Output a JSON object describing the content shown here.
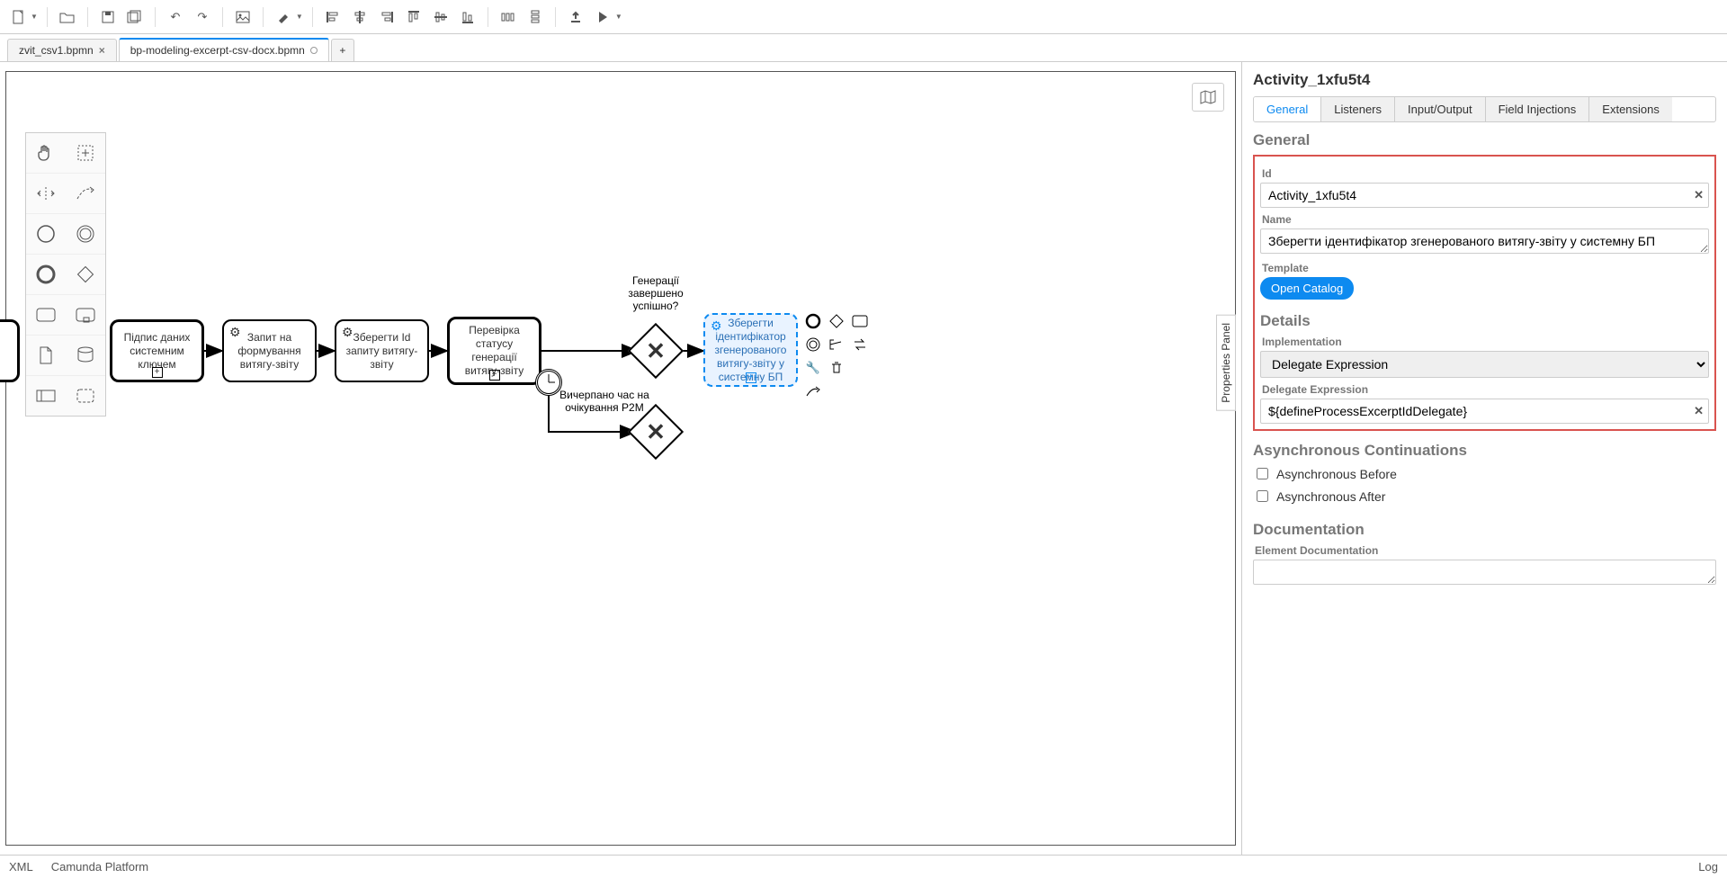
{
  "toolbar": {
    "new": "new",
    "open": "open",
    "save": "save",
    "saveall": "save-all",
    "undo": "undo",
    "redo": "redo",
    "image": "export-image",
    "paint": "color",
    "alignL": "align-left",
    "alignC": "align-center",
    "alignR": "align-right",
    "distH": "distribute-h",
    "distV": "distribute-v",
    "distV2": "distribute",
    "alignT": "align-top",
    "alignB": "align-bottom",
    "upload": "upload",
    "play": "deploy"
  },
  "tabs": {
    "items": [
      {
        "label": "zvit_csv1.bpmn",
        "active": false,
        "dirty": false
      },
      {
        "label": "bp-modeling-excerpt-csv-docx.bpmn",
        "active": true,
        "dirty": true
      }
    ]
  },
  "propsToggle": "Properties Panel",
  "props": {
    "title": "Activity_1xfu5t4",
    "tabs": [
      "General",
      "Listeners",
      "Input/Output",
      "Field Injections",
      "Extensions"
    ],
    "activeTab": 0,
    "sectionGeneral": "General",
    "idLabel": "Id",
    "idValue": "Activity_1xfu5t4",
    "nameLabel": "Name",
    "nameValue": "Зберегти ідентифікатор згенерованого витягу-звіту у системну БП",
    "templateLabel": "Template",
    "openCatalog": "Open Catalog",
    "sectionDetails": "Details",
    "implLabel": "Implementation",
    "implValue": "Delegate Expression",
    "delExpLabel": "Delegate Expression",
    "delExpValue": "${defineProcessExcerptIdDelegate}",
    "sectionAsync": "Asynchronous Continuations",
    "asyncBefore": "Asynchronous Before",
    "asyncAfter": "Asynchronous After",
    "sectionDoc": "Documentation",
    "elemDocLabel": "Element Documentation"
  },
  "diagram": {
    "task1": "Підпис даних системним ключем",
    "task2": "Запит на формування витягу-звіту",
    "task3": "Зберегти Id запиту витягу-звіту",
    "task4": "Перевірка статусу генерації витягу-звіту",
    "task5": "Зберегти ідентифікатор згенерованого витягу-звіту у системну БП",
    "annotTop": "Генерації завершено успішно?",
    "annotBottom": "Вичерпано час на очікування P2M"
  },
  "status": {
    "left1": "XML",
    "left2": "Camunda Platform",
    "right": "Log"
  }
}
